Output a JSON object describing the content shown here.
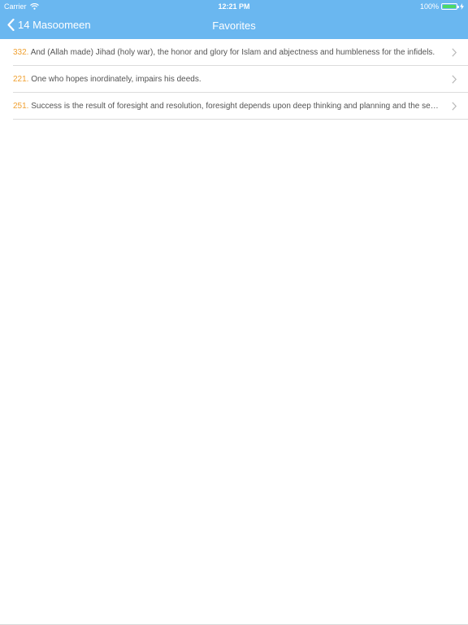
{
  "status_bar": {
    "carrier": "Carrier",
    "time": "12:21 PM",
    "battery": "100%"
  },
  "nav": {
    "back_label": "14 Masoomeen",
    "title": "Favorites"
  },
  "favorites": [
    {
      "number": "332.",
      "text": "And (Allah made) Jihad (holy war), the honor and glory for Islam and abjectness and humbleness for the infidels."
    },
    {
      "number": "221.",
      "text": "One who hopes inordinately, impairs his deeds."
    },
    {
      "number": "251.",
      "text": "Success is the result of foresight and resolution, foresight depends upon deep thinking and planning and the secrets."
    }
  ],
  "colors": {
    "nav_background": "#6ab7f0",
    "number_accent": "#f0a030",
    "battery_fill": "#4cd964"
  },
  "icons": {
    "back": "chevron-left-icon",
    "row_disclosure": "chevron-right-icon",
    "wifi": "wifi-icon",
    "battery": "battery-icon",
    "charging": "charging-bolt-icon"
  }
}
